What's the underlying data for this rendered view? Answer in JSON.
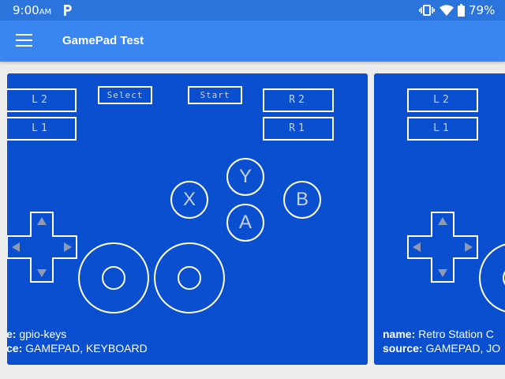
{
  "status_bar": {
    "time": "9:00",
    "ampm": "AM",
    "notification_icon": "p-icon",
    "battery_percent": "79%"
  },
  "app_bar": {
    "menu_icon": "hamburger-menu-icon",
    "title": "GamePad Test"
  },
  "pads": [
    {
      "buttons": {
        "l2": "L2",
        "l1": "L1",
        "select": "Select",
        "start": "Start",
        "r2": "R2",
        "r1": "R1",
        "x": "X",
        "y": "Y",
        "a": "A",
        "b": "B"
      },
      "name_label": "e:",
      "name_value": "gpio-keys",
      "source_label": "ce:",
      "source_value": "GAMEPAD, KEYBOARD"
    },
    {
      "buttons": {
        "l2": "L2",
        "l1": "L1"
      },
      "name_label": "name:",
      "name_value": "Retro Station C",
      "source_label": "source:",
      "source_value": "GAMEPAD, JO"
    }
  ]
}
